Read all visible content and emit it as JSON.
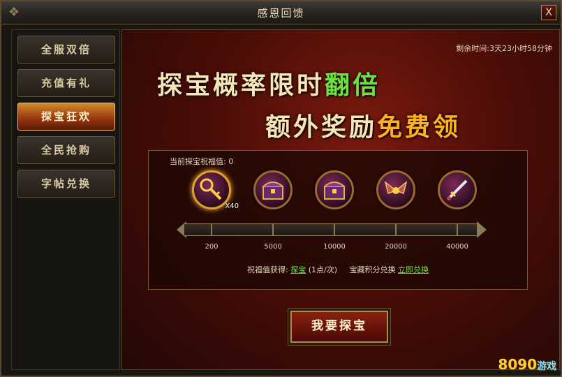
{
  "window": {
    "title": "感恩回馈",
    "close_label": "X"
  },
  "sidebar": {
    "items": [
      {
        "label": "全服双倍",
        "active": false
      },
      {
        "label": "充值有礼",
        "active": false
      },
      {
        "label": "探宝狂欢",
        "active": true
      },
      {
        "label": "全民抢购",
        "active": false
      },
      {
        "label": "字帖兑换",
        "active": false
      }
    ]
  },
  "timer": {
    "label": "剩余时间:",
    "value": "3天23小时58分钟"
  },
  "slogan": {
    "line1_a": "探宝概率限时",
    "line1_b": "翻倍",
    "line2_a": "额外奖励",
    "line2_b": "免费领"
  },
  "treasure": {
    "bless_label": "当前探宝祝福值:",
    "bless_value": "0",
    "rewards": [
      {
        "icon": "golden-key-icon",
        "qty": "X40"
      },
      {
        "icon": "treasure-chest-icon",
        "qty": ""
      },
      {
        "icon": "treasure-chest-icon",
        "qty": ""
      },
      {
        "icon": "wings-item-icon",
        "qty": ""
      },
      {
        "icon": "sword-item-icon",
        "qty": ""
      }
    ],
    "milestones": [
      "200",
      "5000",
      "10000",
      "20000",
      "40000"
    ],
    "gain_label": "祝福值获得:",
    "gain_link": "探宝",
    "gain_rate": "(1点/次)",
    "exchange_label": "宝藏积分兑换",
    "exchange_link": "立即兑换"
  },
  "button": {
    "label": "我要探宝"
  },
  "logo": {
    "text": "8090",
    "sub": "游戏"
  },
  "colors": {
    "accent": "#ffb01e",
    "highlight": "#6fe041"
  }
}
